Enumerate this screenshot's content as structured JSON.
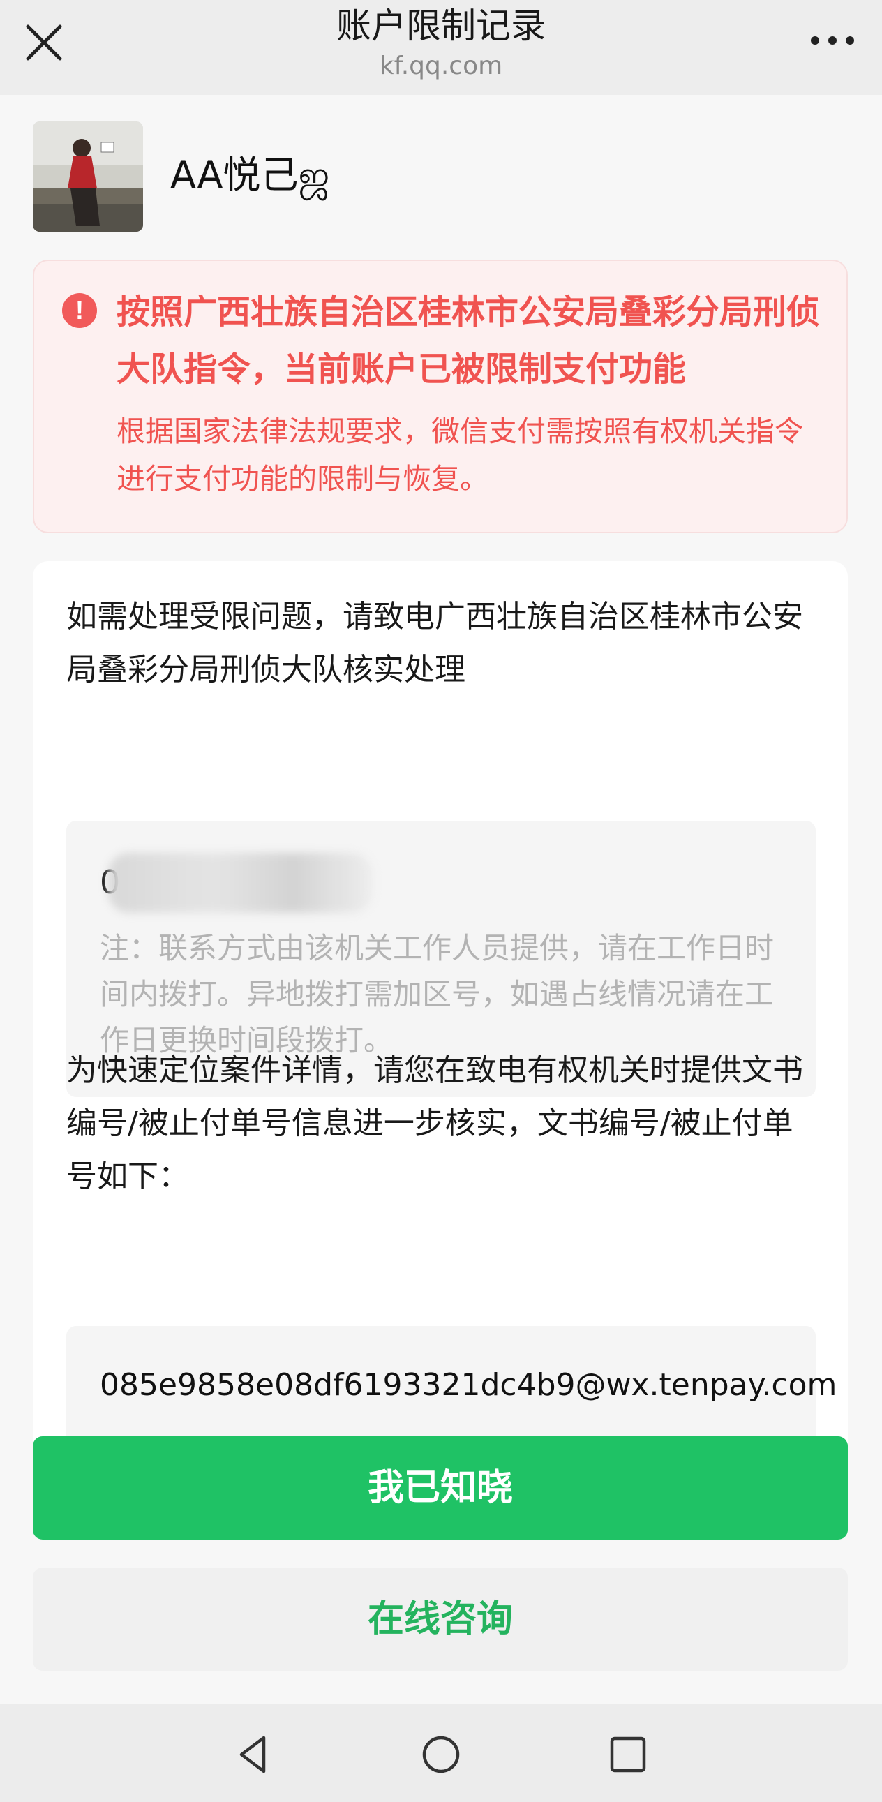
{
  "nav": {
    "title": "账户限制记录",
    "subtitle": "kf.qq.com",
    "close_icon": "close-icon",
    "more_icon": "more-dots-icon"
  },
  "profile": {
    "name": "AA悦己ஜ"
  },
  "alert": {
    "title": "按照广西壮族自治区桂林市公安局叠彩分局刑侦大队指令，当前账户已被限制支付功能",
    "description": "根据国家法律法规要求，微信支付需按照有权机关指令进行支付功能的限制与恢复。",
    "icon": "exclamation-icon",
    "color": "#f05350"
  },
  "contact": {
    "instruction": "如需处理受限问题，请致电广西壮族自治区桂林市公安局叠彩分局刑侦大队核实处理",
    "phone": "0",
    "note": "注：联系方式由该机关工作人员提供，请在工作日时间内拨打。异地拨打需加区号，如遇占线情况请在工作日更换时间段拨打。"
  },
  "document": {
    "instruction": "为快速定位案件详情，请您在致电有权机关时提供文书编号/被止付单号信息进一步核实，文书编号/被止付单号如下：",
    "number": "085e9858e08df6193321dc4b9@wx.tenpay.com"
  },
  "buttons": {
    "primary": "我已知晓",
    "secondary": "在线咨询",
    "primary_color": "#1fc265",
    "secondary_text_color": "#24b35e"
  },
  "system_nav": {
    "back_icon": "triangle-back-icon",
    "home_icon": "circle-home-icon",
    "recents_icon": "square-recents-icon"
  }
}
